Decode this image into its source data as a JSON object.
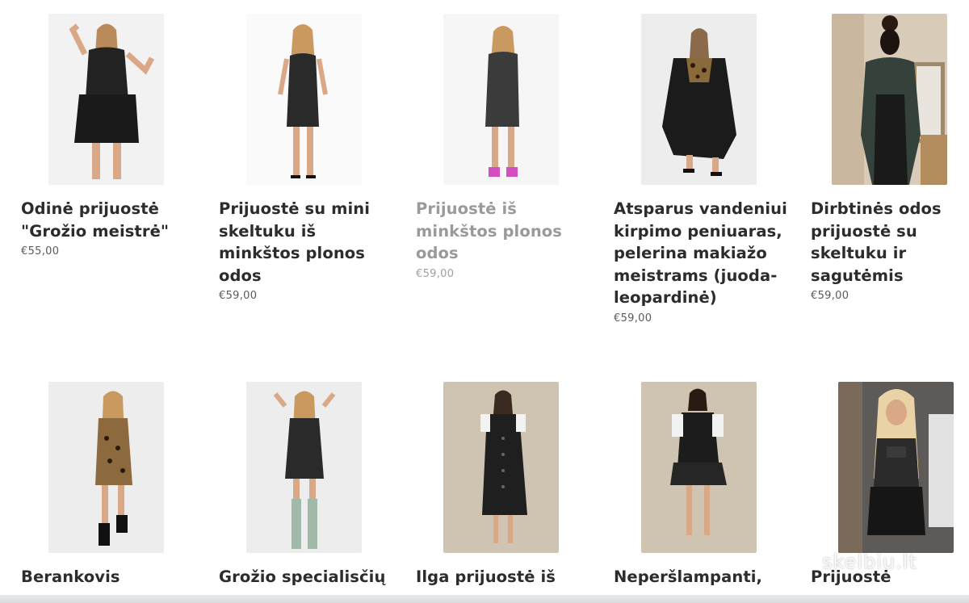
{
  "products": [
    {
      "title": "Odinė prijuostė \"Grožio meistrė\"",
      "price": "€55,00",
      "image": "model-black-peplum-apron"
    },
    {
      "title": "Prijuostė su mini skeltuku iš minkštos plonos odos",
      "price": "€59,00",
      "image": "model-black-leather-apron"
    },
    {
      "title": "Prijuostė iš minkštos plonos odos",
      "price": "€59,00",
      "image": "model-leather-apron-pink-heels"
    },
    {
      "title": "Atsparus vandeniui kirpimo peniuaras, pelerina makiažo meistrams (juoda-leopardinė)",
      "price": "€59,00",
      "image": "model-cape-leopard"
    },
    {
      "title": "Dirbtinės odos prijuostė su skeltuku ir sagutėmis",
      "price": "€59,00",
      "image": "model-back-view-salon"
    },
    {
      "title": "Berankovis",
      "price": "",
      "image": "model-leopard-dress"
    },
    {
      "title": "Grožio specialisčių",
      "price": "",
      "image": "model-leather-dress-boots"
    },
    {
      "title": "Ilga prijuostė iš",
      "price": "",
      "image": "model-long-button-apron"
    },
    {
      "title": "Neperšlampanti,",
      "price": "",
      "image": "model-short-apron"
    },
    {
      "title": "Prijuostė",
      "price": "",
      "image": "model-blonde-apron"
    }
  ],
  "watermark": "skelbiu.lt"
}
